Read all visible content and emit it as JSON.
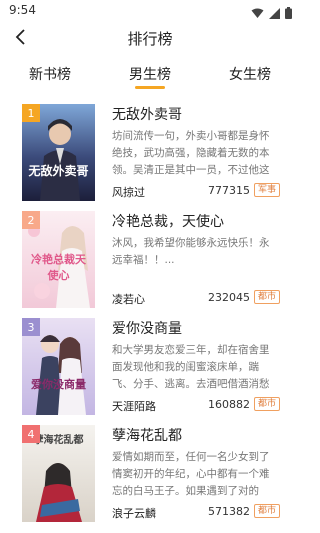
{
  "status_bar": {
    "time": "9:54"
  },
  "header": {
    "title": "排行榜"
  },
  "tabs": [
    {
      "label": "新书榜"
    },
    {
      "label": "男生榜"
    },
    {
      "label": "女生榜"
    }
  ],
  "books": [
    {
      "rank": "1",
      "rank_color": "#f5a623",
      "cover_text": "无敌外卖哥",
      "title": "无敌外卖哥",
      "description": "坊间流传一句，外卖小哥都是身怀绝技，武功高强，隐藏着无数的本领。吴清正是其中一员，不过他这个外...",
      "author": "风掠过",
      "count": "777315",
      "tag": "军事"
    },
    {
      "rank": "2",
      "rank_color": "#f8a98a",
      "cover_text": "冷艳总裁天使心",
      "title": "冷艳总裁，天使心",
      "description": "沐风，我希望你能够永远快乐！永远幸福！！...",
      "author": "凌若心",
      "count": "232045",
      "tag": "都市"
    },
    {
      "rank": "3",
      "rank_color": "#9b8fd0",
      "cover_text": "爱你没商量",
      "title": "爱你没商量",
      "description": "和大学男友恋爱三年，却在宿舍里面发现他和我的闺蜜滚床单，踹飞、分手、逃离。去酒吧借酒消愁却意...",
      "author": "天涯陌路",
      "count": "160882",
      "tag": "都市"
    },
    {
      "rank": "4",
      "rank_color": "#f07070",
      "cover_text": "孽海花乱都",
      "title": "孽海花乱都",
      "description": "爱情如期而至，任何一名少女到了情窦初开的年纪，心中都有一个难忘的白马王子。如果遇到了对的人，不...",
      "author": "浪子云麟",
      "count": "571382",
      "tag": "都市"
    }
  ]
}
